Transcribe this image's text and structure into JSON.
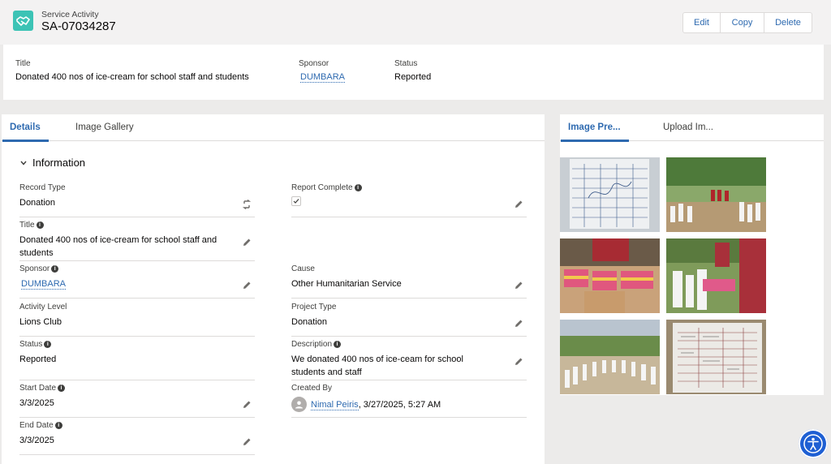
{
  "header": {
    "object_type": "Service Activity",
    "record_name": "SA-07034287",
    "actions": [
      "Edit",
      "Copy",
      "Delete"
    ]
  },
  "highlights": {
    "title_label": "Title",
    "title_value": "Donated 400 nos of ice-cream for school staff and students",
    "sponsor_label": "Sponsor",
    "sponsor_value": "DUMBARA",
    "status_label": "Status",
    "status_value": "Reported"
  },
  "left_tabs": [
    "Details",
    "Image Gallery"
  ],
  "section": {
    "title": "Information"
  },
  "fields": {
    "record_type": {
      "label": "Record Type",
      "value": "Donation"
    },
    "report_complete": {
      "label": "Report Complete",
      "checked": true
    },
    "title": {
      "label": "Title",
      "value": "Donated 400 nos of ice-cream for school staff and students"
    },
    "sponsor": {
      "label": "Sponsor",
      "value": "DUMBARA"
    },
    "cause": {
      "label": "Cause",
      "value": "Other Humanitarian Service"
    },
    "activity_level": {
      "label": "Activity Level",
      "value": "Lions Club"
    },
    "project_type": {
      "label": "Project Type",
      "value": "Donation"
    },
    "status": {
      "label": "Status",
      "value": "Reported"
    },
    "description": {
      "label": "Description",
      "value": "We donated 400 nos of ice-ceam for school students and staff"
    },
    "start_date": {
      "label": "Start Date",
      "value": "3/3/2025"
    },
    "created_by": {
      "label": "Created By",
      "user": "Nimal Peiris",
      "when": ", 3/27/2025, 5:27 AM"
    },
    "end_date": {
      "label": "End Date",
      "value": "3/3/2025"
    }
  },
  "right_tabs": [
    "Image Pre...",
    "Upload Im..."
  ],
  "colors": {
    "brand": "#2e6ab0",
    "icon_bg": "#3cc3b5",
    "a11y": "#1e5fd3"
  }
}
